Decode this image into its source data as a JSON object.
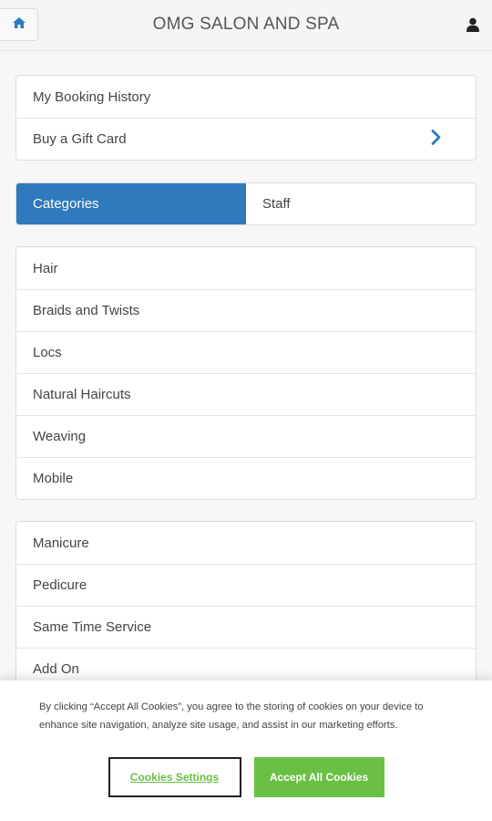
{
  "header": {
    "title": "OMG SALON AND SPA",
    "home_icon": "home-icon",
    "user_icon": "user-icon"
  },
  "account_menu": [
    {
      "label": "My Booking History"
    },
    {
      "label": "Buy a Gift Card",
      "icon": "chevron-right-icon"
    }
  ],
  "tabs": [
    {
      "label": "Categories",
      "active": true
    },
    {
      "label": "Staff",
      "active": false
    }
  ],
  "categories_group_1": [
    "Hair",
    "Braids and Twists",
    "Locs",
    "Natural Haircuts",
    "Weaving",
    "Mobile"
  ],
  "categories_group_2": [
    "Manicure",
    "Pedicure",
    "Same Time Service",
    "Add On"
  ],
  "cookie_banner": {
    "text": "By clicking “Accept All Cookies”, you agree to the storing of cookies on your device to enhance site navigation, analyze site usage, and assist in our marketing efforts.",
    "settings_label": "Cookies Settings",
    "accept_label": "Accept All Cookies"
  },
  "colors": {
    "active_tab": "#2f79bc",
    "chevron": "#2f79bc",
    "accept_button": "#6abf45",
    "settings_text": "#6abf45"
  }
}
